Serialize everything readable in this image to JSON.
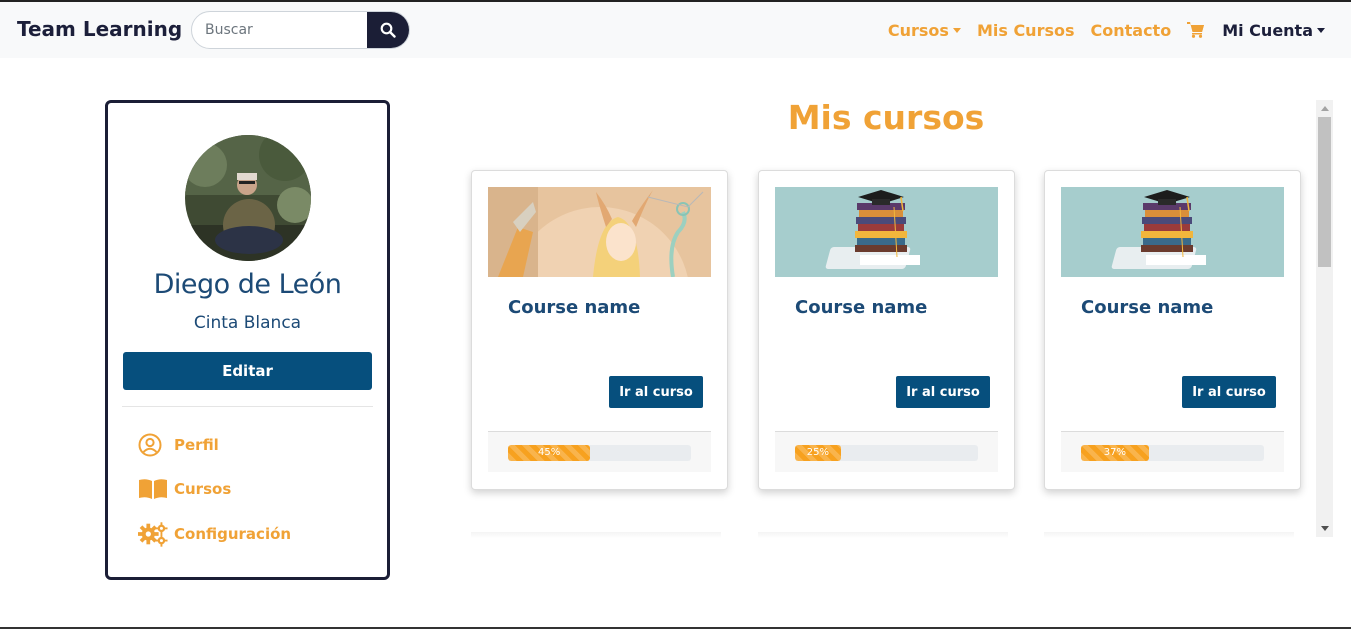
{
  "navbar": {
    "brand": "Team Learning",
    "search": {
      "placeholder": "Buscar"
    },
    "links": {
      "cursos": "Cursos",
      "mis_cursos": "Mis Cursos",
      "contacto": "Contacto",
      "account": "Mi Cuenta"
    },
    "cart_icon": "shopping-cart-icon"
  },
  "profile": {
    "name": "Diego de León",
    "rank": "Cinta Blanca",
    "edit_label": "Editar",
    "menu": [
      {
        "label": "Perfil",
        "icon": "user-circle-icon"
      },
      {
        "label": "Cursos",
        "icon": "open-book-icon"
      },
      {
        "label": "Configuración",
        "icon": "gears-icon"
      }
    ]
  },
  "main": {
    "title": "Mis cursos",
    "courses": [
      {
        "name": "Course name",
        "button": "Ir al curso",
        "progress": 45,
        "progress_label": "45%",
        "image": "fantasy-illustration"
      },
      {
        "name": "Course name",
        "button": "Ir al curso",
        "progress": 25,
        "progress_label": "25%",
        "image": "graduation-books"
      },
      {
        "name": "Course name",
        "button": "Ir al curso",
        "progress": 37,
        "progress_label": "37%",
        "image": "graduation-books"
      }
    ]
  },
  "colors": {
    "accent": "#f0a236",
    "primary": "#064f7d",
    "dark": "#1b1e36"
  }
}
